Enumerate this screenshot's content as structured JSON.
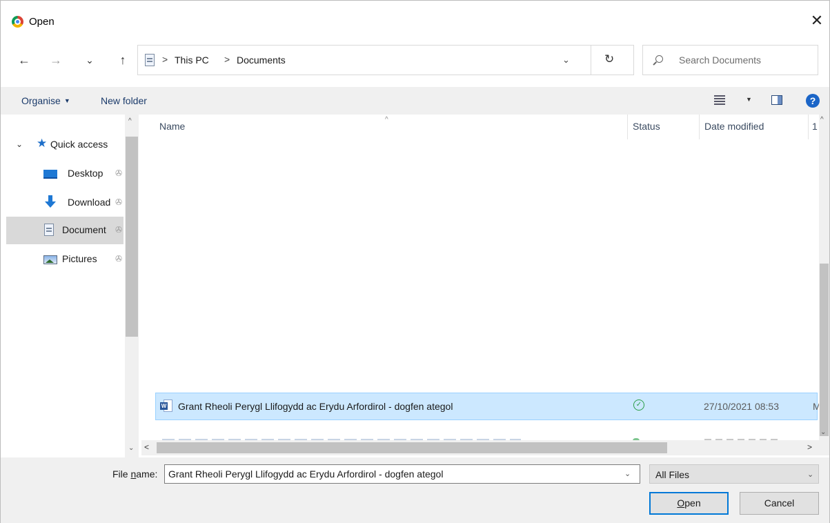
{
  "window": {
    "title": "Open",
    "close_glyph": "✕"
  },
  "nav": {
    "back_glyph": "←",
    "forward_glyph": "→",
    "recent_glyph": "⌄",
    "up_glyph": "↑",
    "breadcrumbs": [
      "This PC",
      "Documents"
    ],
    "crumb_separator": ">",
    "dropdown_glyph": "⌄",
    "refresh_glyph": "↻",
    "search_placeholder": "Search Documents"
  },
  "toolbar": {
    "organise_label": "Organise",
    "organise_caret": "▼",
    "new_folder_label": "New folder",
    "view_caret": "▼",
    "help_glyph": "?"
  },
  "sidebar": {
    "quick_access": {
      "label": "Quick access",
      "expander": "⌄",
      "icon": "star-icon"
    },
    "items": [
      {
        "label": "Desktop",
        "icon": "desktop-icon",
        "pin": "📌"
      },
      {
        "label": "Download",
        "icon": "download-icon",
        "pin": "📌"
      },
      {
        "label": "Document",
        "icon": "documents-icon",
        "pin": "📌",
        "selected": true
      },
      {
        "label": "Pictures",
        "icon": "pictures-icon",
        "pin": "📌"
      }
    ]
  },
  "file_list": {
    "columns": [
      "Name",
      "Status",
      "Date modified",
      "1"
    ],
    "sort_glyph": "^",
    "rows": [
      {
        "name": "Grant Rheoli Perygl Llifogydd ac Erydu Arfordirol - dogfen ategol",
        "status": "synced",
        "status_glyph": "✓",
        "date_modified": "27/10/2021 08:53",
        "more": "M",
        "icon": "word-doc-icon",
        "selected": true
      }
    ]
  },
  "scroll": {
    "up": "^",
    "down": "⌄",
    "left": "<",
    "right": ">"
  },
  "bottom": {
    "file_name_label": "File name:",
    "file_name_value": "Grant Rheoli Perygl Llifogydd ac Erydu Arfordirol - dogfen ategol",
    "file_name_dropdown": "⌄",
    "file_type_value": "All Files",
    "file_type_dropdown": "⌄",
    "open_label": "Open",
    "cancel_label": "Cancel"
  },
  "colors": {
    "accent": "#0078d7",
    "selection": "#cce8ff",
    "selection_border": "#99d1ff",
    "status_ok": "#2a9d46",
    "help": "#1b65c7"
  }
}
